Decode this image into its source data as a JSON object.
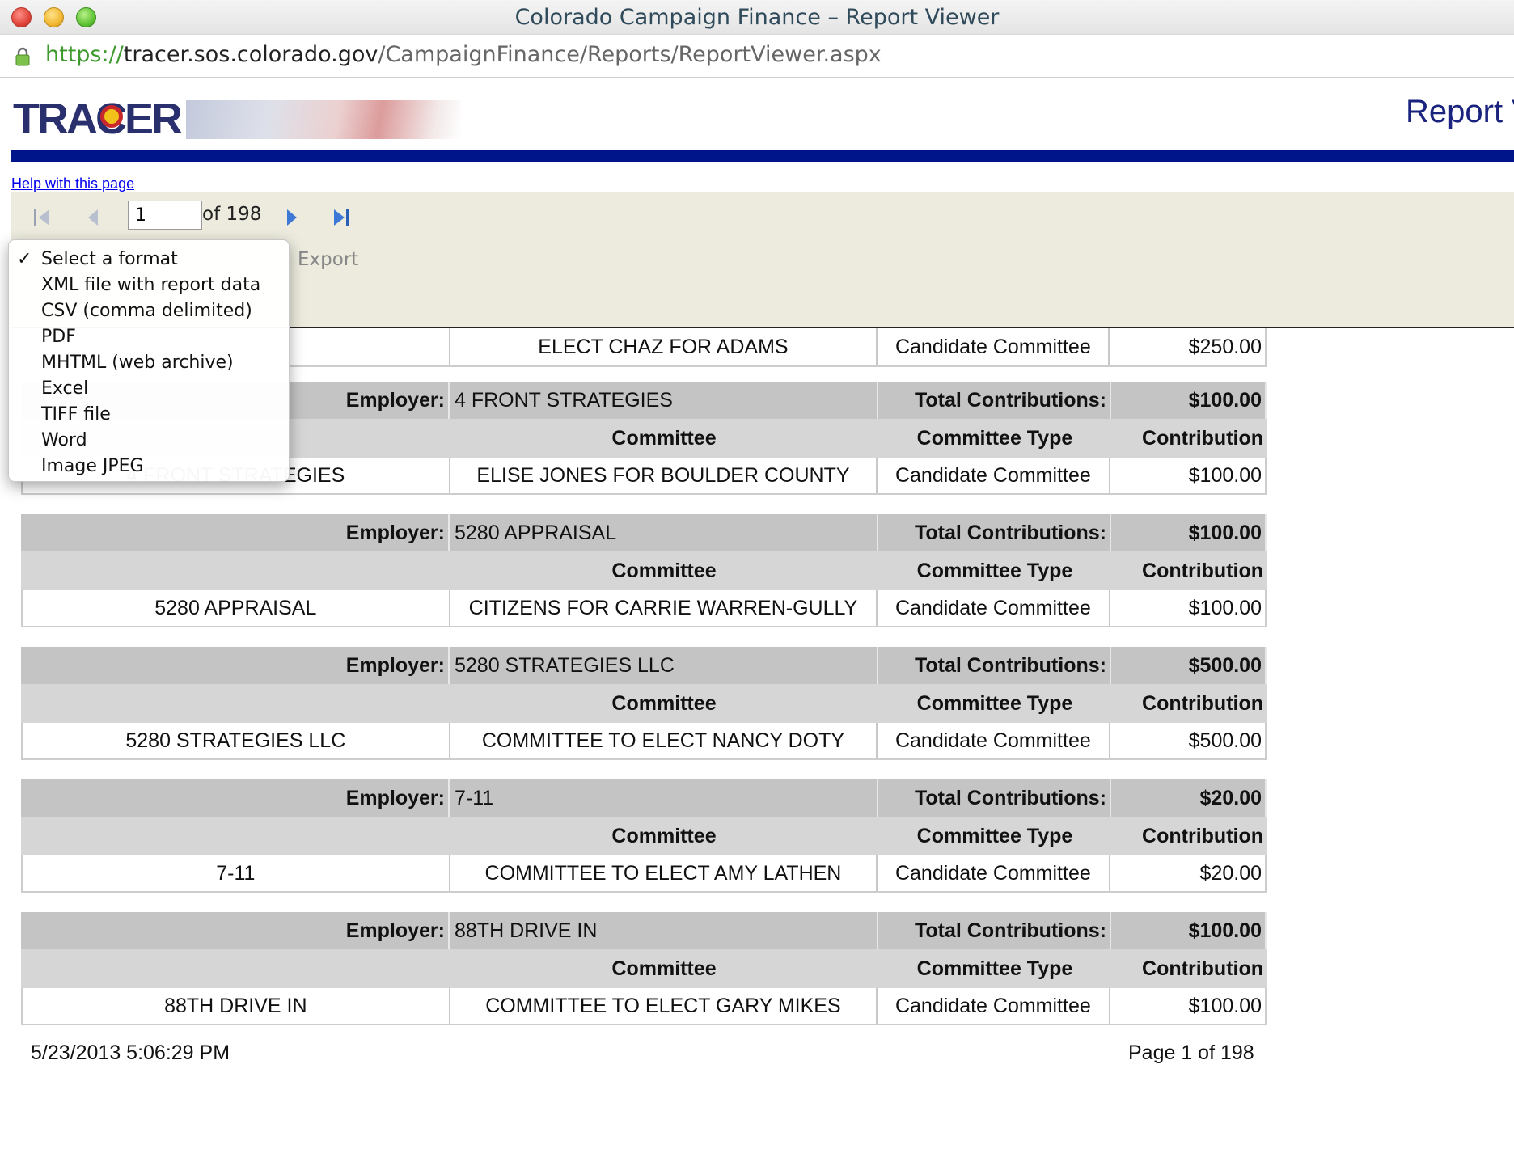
{
  "window": {
    "title": "Colorado Campaign Finance – Report Viewer"
  },
  "url": {
    "scheme": "https://",
    "host": "tracer.sos.colorado.gov",
    "path": "/CampaignFinance/Reports/ReportViewer.aspx"
  },
  "header": {
    "logo_text": "TRACER",
    "page_heading": "Report V"
  },
  "help_link": "Help with this page",
  "toolbar": {
    "current_page": "1",
    "page_of": "of 198",
    "export_label": "Export"
  },
  "format_menu": {
    "selected": "Select a format",
    "options": [
      "Select a format",
      "XML file with report data",
      "CSV (comma delimited)",
      "PDF",
      "MHTML (web archive)",
      "Excel",
      "TIFF file",
      "Word",
      "Image JPEG"
    ]
  },
  "labels": {
    "employer": "Employer:",
    "total_contributions": "Total Contributions:",
    "committee": "Committee",
    "committee_type": "Committee Type",
    "contribution": "Contribution"
  },
  "partial_row": {
    "committee": "ELECT CHAZ FOR ADAMS",
    "committee_type": "Candidate Committee",
    "amount": "$250.00"
  },
  "groups": [
    {
      "employer": "4 FRONT STRATEGIES",
      "total": "$100.00",
      "row_employer": "4 FRONT STRATEGIES",
      "committee": "ELISE JONES FOR BOULDER COUNTY",
      "committee_type": "Candidate Committee",
      "amount": "$100.00"
    },
    {
      "employer": "5280 APPRAISAL",
      "total": "$100.00",
      "row_employer": "5280 APPRAISAL",
      "committee": "CITIZENS FOR CARRIE WARREN-GULLY",
      "committee_type": "Candidate Committee",
      "amount": "$100.00"
    },
    {
      "employer": "5280 STRATEGIES LLC",
      "total": "$500.00",
      "row_employer": "5280 STRATEGIES LLC",
      "committee": "COMMITTEE TO ELECT NANCY DOTY",
      "committee_type": "Candidate Committee",
      "amount": "$500.00"
    },
    {
      "employer": "7-11",
      "total": "$20.00",
      "row_employer": "7-11",
      "committee": "COMMITTEE TO ELECT AMY LATHEN",
      "committee_type": "Candidate Committee",
      "amount": "$20.00"
    },
    {
      "employer": "88TH DRIVE IN",
      "total": "$100.00",
      "row_employer": "88TH DRIVE IN",
      "committee": "COMMITTEE TO ELECT GARY MIKES",
      "committee_type": "Candidate Committee",
      "amount": "$100.00"
    }
  ],
  "footer": {
    "timestamp": "5/23/2013 5:06:29 PM",
    "page_label": "Page 1 of 198"
  }
}
